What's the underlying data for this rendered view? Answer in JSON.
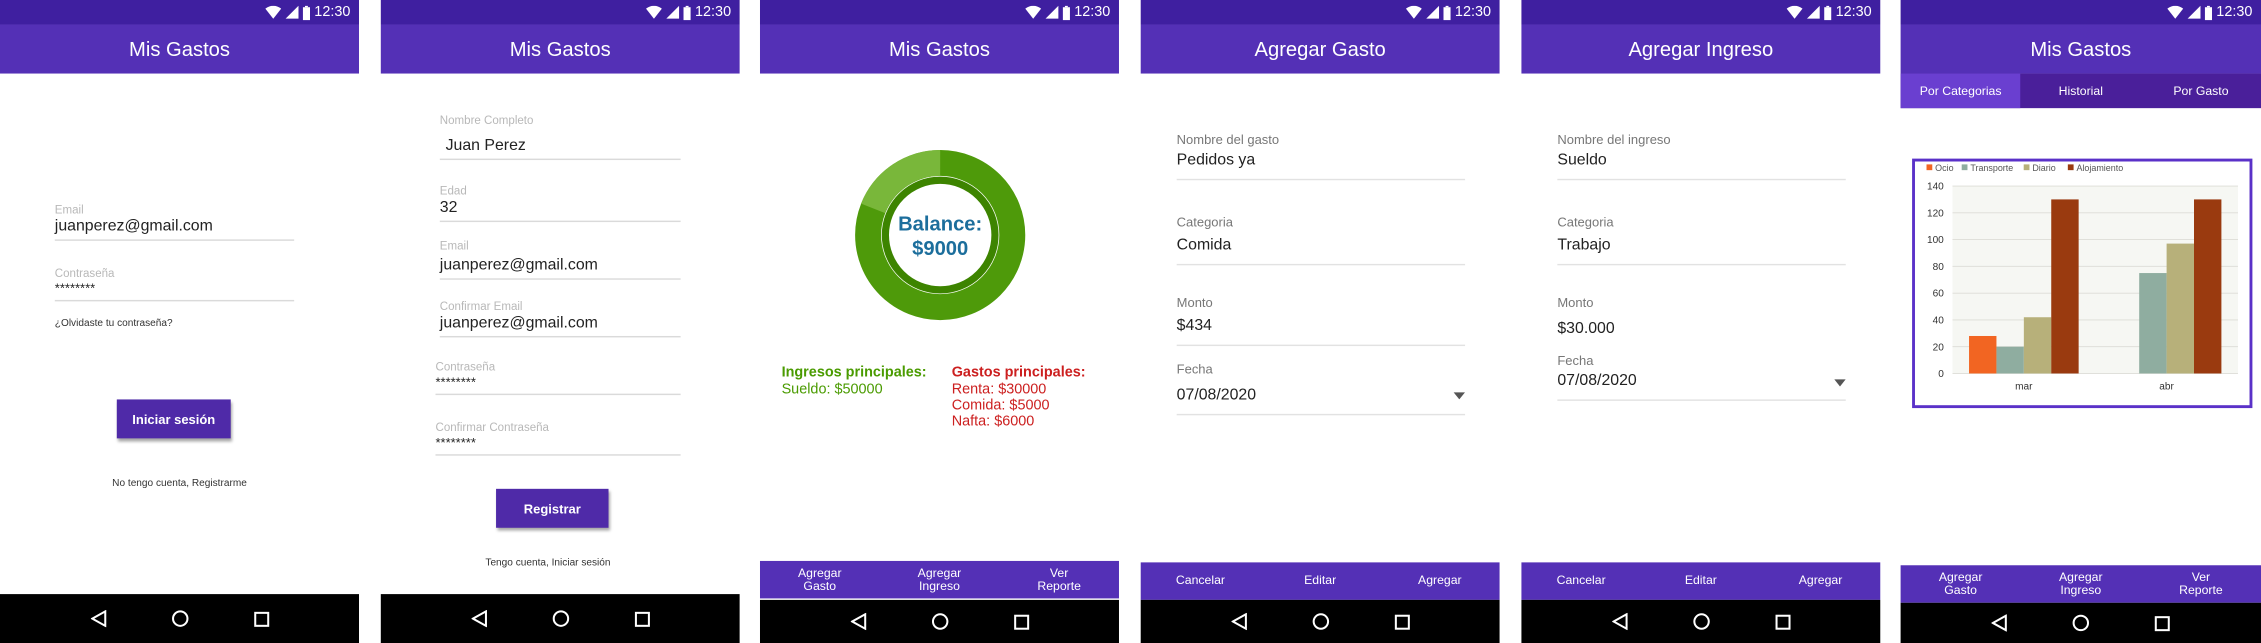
{
  "status": {
    "time": "12:30"
  },
  "screens": {
    "login": {
      "title": "Mis Gastos",
      "email_label": "Email",
      "email_value": "juanperez@gmail.com",
      "password_label": "Contraseña",
      "password_value": "********",
      "forgot_link": "¿Olvidaste tu contraseña?",
      "login_button": "Iniciar sesión",
      "register_link": "No tengo cuenta, Registrarme"
    },
    "register": {
      "title": "Mis Gastos",
      "name_label": "Nombre Completo",
      "name_value": "Juan Perez",
      "age_label": "Edad",
      "age_value": "32",
      "email_label": "Email",
      "email_value": "juanperez@gmail.com",
      "confirm_email_label": "Confirmar Email",
      "confirm_email_value": "juanperez@gmail.com",
      "password_label": "Contraseña",
      "password_value": "********",
      "confirm_password_label": "Confirmar Contraseña",
      "confirm_password_value": "********",
      "register_button": "Registrar",
      "login_link": "Tengo cuenta, Iniciar sesión"
    },
    "balance": {
      "title": "Mis Gastos",
      "balance_label": "Balance:",
      "balance_value": "$9000",
      "income_title": "Ingresos principales:",
      "income_items": [
        "Sueldo: $50000"
      ],
      "expense_title": "Gastos principales:",
      "expense_items": [
        "Renta: $30000",
        "Comida: $5000",
        "Nafta: $6000"
      ],
      "actions": [
        "Agregar Gasto",
        "Agregar Ingreso",
        "Ver Reporte"
      ],
      "colors": {
        "ring_dark": "#4e9a0a",
        "ring_light": "#79b73a",
        "balance_text": "#1c6e9c",
        "income": "#4a9b00",
        "expense": "#cc1f1f"
      }
    },
    "add_expense": {
      "title": "Agregar Gasto",
      "fields": [
        {
          "label": "Nombre del gasto",
          "value": "Pedidos ya"
        },
        {
          "label": "Categoria",
          "value": "Comida"
        },
        {
          "label": "Monto",
          "value": "$434"
        },
        {
          "label": "Fecha",
          "value": "07/08/2020"
        }
      ],
      "actions": [
        "Cancelar",
        "Editar",
        "Agregar"
      ]
    },
    "add_income": {
      "title": "Agregar Ingreso",
      "fields": [
        {
          "label": "Nombre del ingreso",
          "value": "Sueldo"
        },
        {
          "label": "Categoria",
          "value": "Trabajo"
        },
        {
          "label": "Monto",
          "value": "$30.000"
        },
        {
          "label": "Fecha",
          "value": "07/08/2020"
        }
      ],
      "actions": [
        "Cancelar",
        "Editar",
        "Agregar"
      ]
    },
    "report": {
      "title": "Mis Gastos",
      "tabs": [
        "Por Categorias",
        "Historial",
        "Por Gasto"
      ],
      "actions": [
        "Agregar Gasto",
        "Agregar Ingreso",
        "Ver Reporte"
      ]
    }
  },
  "chart_data": {
    "type": "bar",
    "categories": [
      "mar",
      "abr"
    ],
    "series": [
      {
        "name": "Ocio",
        "color": "#f26522",
        "values": [
          28,
          null
        ]
      },
      {
        "name": "Transporte",
        "color": "#8fada0",
        "values": [
          20,
          75
        ]
      },
      {
        "name": "Diario",
        "color": "#b7b07a",
        "values": [
          42,
          97
        ]
      },
      {
        "name": "Alojamiento",
        "color": "#9a3a0f",
        "values": [
          130,
          130
        ]
      }
    ],
    "ylim": [
      0,
      140
    ],
    "yticks": [
      0,
      20,
      40,
      60,
      80,
      100,
      120,
      140
    ],
    "grid": true,
    "legend": "top-left"
  }
}
